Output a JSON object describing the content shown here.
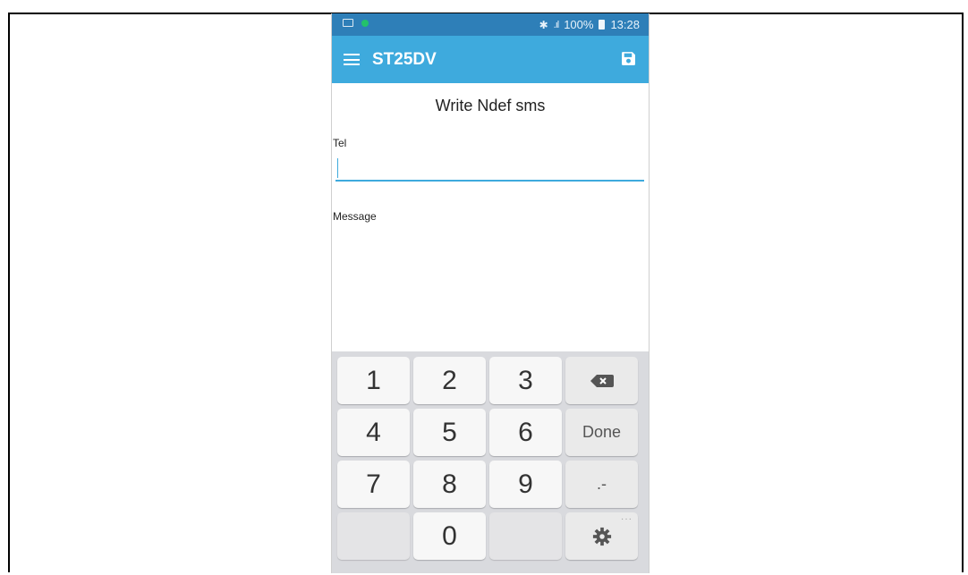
{
  "status_bar": {
    "battery": "100%",
    "time": "13:28"
  },
  "app_bar": {
    "title": "ST25DV"
  },
  "screen": {
    "title": "Write Ndef sms",
    "tel_label": "Tel",
    "tel_value": "",
    "message_label": "Message"
  },
  "keyboard": {
    "rows": [
      [
        "1",
        "2",
        "3",
        "backspace"
      ],
      [
        "4",
        "5",
        "6",
        "Done"
      ],
      [
        "7",
        "8",
        "9",
        ".-"
      ],
      [
        "",
        "0",
        "",
        "settings"
      ]
    ],
    "done_label": "Done",
    "punct_label": ".-"
  },
  "colors": {
    "status_bar": "#2e7fb8",
    "app_bar": "#3eaadd",
    "accent": "#3eaadd"
  }
}
